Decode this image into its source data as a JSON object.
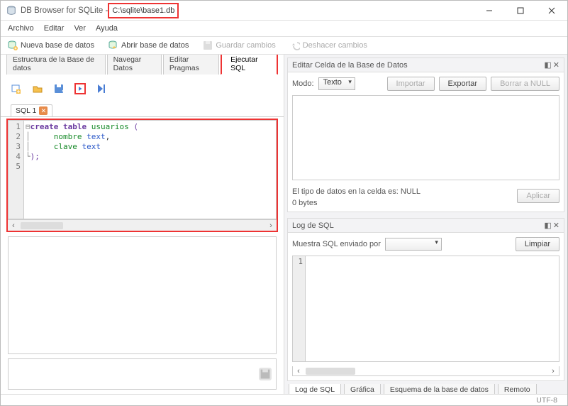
{
  "titlebar": {
    "app": "DB Browser for SQLite - ",
    "path": "C:\\sqlite\\base1.db"
  },
  "menubar": {
    "items": [
      "Archivo",
      "Editar",
      "Ver",
      "Ayuda"
    ]
  },
  "toolbar": {
    "new_db": "Nueva base de datos",
    "open_db": "Abrir base de datos",
    "save": "Guardar cambios",
    "revert": "Deshacer cambios"
  },
  "tabs": {
    "items": [
      "Estructura de la Base de datos",
      "Navegar Datos",
      "Editar Pragmas",
      "Ejecutar SQL"
    ],
    "active_index": 3
  },
  "sql": {
    "file_tab": "SQL 1",
    "gutter": [
      "1",
      "2",
      "3",
      "4",
      "5"
    ],
    "code": {
      "l1_a": "create",
      "l1_b": "table",
      "l1_c": "usuarios",
      "l1_d": "(",
      "l2_a": "nombre",
      "l2_b": "text",
      "l3_a": "clave",
      "l3_b": "text",
      "l4": ");"
    }
  },
  "edit_pane": {
    "title": "Editar Celda de la Base de Datos",
    "mode_label": "Modo:",
    "mode_value": "Texto",
    "import": "Importar",
    "export": "Exportar",
    "null": "Borrar a NULL",
    "type_info": "El tipo de datos en la celda es: NULL",
    "size_info": "0 bytes",
    "apply": "Aplicar"
  },
  "log_pane": {
    "title": "Log de SQL",
    "filter_label": "Muestra SQL enviado por",
    "clear": "Limpiar",
    "row1": "1"
  },
  "right_tabs": {
    "items": [
      "Log de SQL",
      "Gráfica",
      "Esquema de la base de datos",
      "Remoto"
    ],
    "active_index": 0
  },
  "statusbar": {
    "encoding": "UTF-8"
  }
}
